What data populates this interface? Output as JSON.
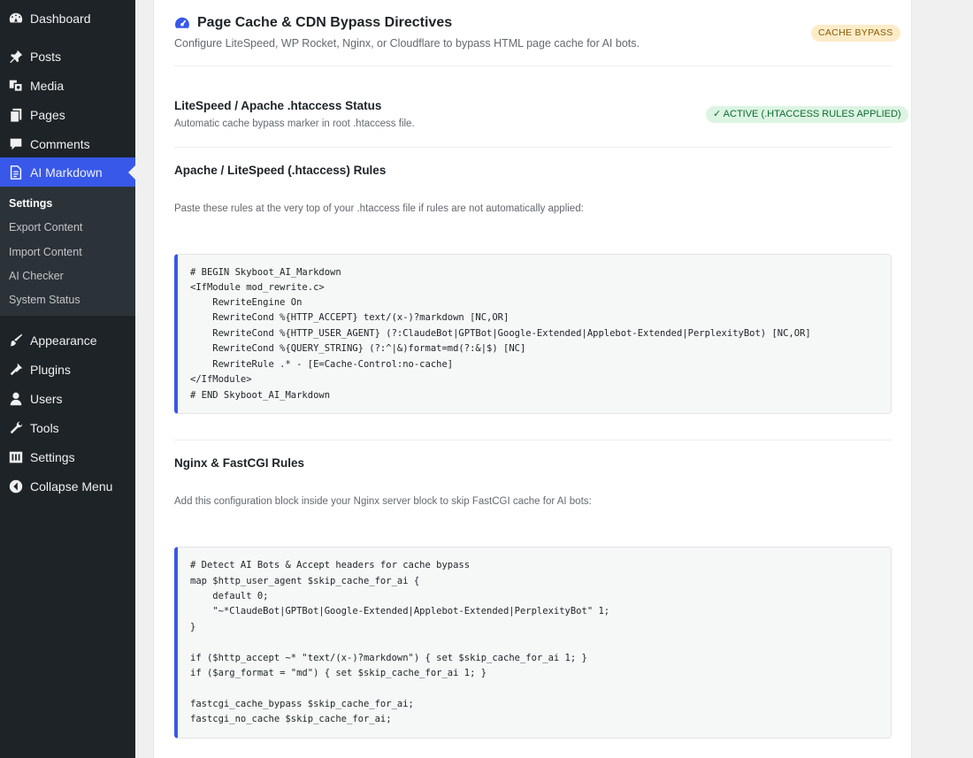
{
  "sidebar": {
    "items": [
      {
        "label": "Dashboard",
        "icon": "dashboard-icon"
      },
      {
        "label": "Posts",
        "icon": "pin-icon"
      },
      {
        "label": "Media",
        "icon": "media-icon"
      },
      {
        "label": "Pages",
        "icon": "pages-icon"
      },
      {
        "label": "Comments",
        "icon": "comment-icon"
      },
      {
        "label": "AI Markdown",
        "icon": "document-icon"
      },
      {
        "label": "Appearance",
        "icon": "brush-icon"
      },
      {
        "label": "Plugins",
        "icon": "plugin-icon"
      },
      {
        "label": "Users",
        "icon": "user-icon"
      },
      {
        "label": "Tools",
        "icon": "wrench-icon"
      },
      {
        "label": "Settings",
        "icon": "settings-icon"
      },
      {
        "label": "Collapse Menu",
        "icon": "collapse-icon"
      }
    ],
    "submenu": [
      "Settings",
      "Export Content",
      "Import Content",
      "AI Checker",
      "System Status"
    ]
  },
  "header": {
    "title": "Page Cache & CDN Bypass Directives",
    "subtitle": "Configure LiteSpeed, WP Rocket, Nginx, or Cloudflare to bypass HTML page cache for AI bots.",
    "badge": "CACHE BYPASS",
    "icon": "speedometer-icon"
  },
  "status": {
    "title": "LiteSpeed / Apache .htaccess Status",
    "desc": "Automatic cache bypass marker in root .htaccess file.",
    "badge": "✓ ACTIVE (.HTACCESS RULES APPLIED)"
  },
  "apache": {
    "title": "Apache / LiteSpeed (.htaccess) Rules",
    "desc": "Paste these rules at the very top of your .htaccess file if rules are not automatically applied:",
    "code": [
      "# BEGIN Skyboot_AI_Markdown",
      "<IfModule mod_rewrite.c>",
      "    RewriteEngine On",
      "    RewriteCond %{HTTP_ACCEPT} text/(x-)?markdown [NC,OR]",
      "    RewriteCond %{HTTP_USER_AGENT} (?:ClaudeBot|GPTBot|Google-Extended|Applebot-Extended|PerplexityBot) [NC,OR]",
      "    RewriteCond %{QUERY_STRING} (?:^|&)format=md(?:&|$) [NC]",
      "    RewriteRule .* - [E=Cache-Control:no-cache]",
      "</IfModule>",
      "# END Skyboot_AI_Markdown"
    ]
  },
  "nginx": {
    "title": "Nginx & FastCGI Rules",
    "desc": "Add this configuration block inside your Nginx server block to skip FastCGI cache for AI bots:",
    "code": [
      "# Detect AI Bots & Accept headers for cache bypass",
      "map $http_user_agent $skip_cache_for_ai {",
      "    default 0;",
      "    \"~*ClaudeBot|GPTBot|Google-Extended|Applebot-Extended|PerplexityBot\" 1;",
      "}",
      "",
      "if ($http_accept ~* \"text/(x-)?markdown\") { set $skip_cache_for_ai 1; }",
      "if ($arg_format = \"md\") { set $skip_cache_for_ai 1; }",
      "",
      "fastcgi_cache_bypass $skip_cache_for_ai;",
      "fastcgi_no_cache $skip_cache_for_ai;"
    ]
  }
}
